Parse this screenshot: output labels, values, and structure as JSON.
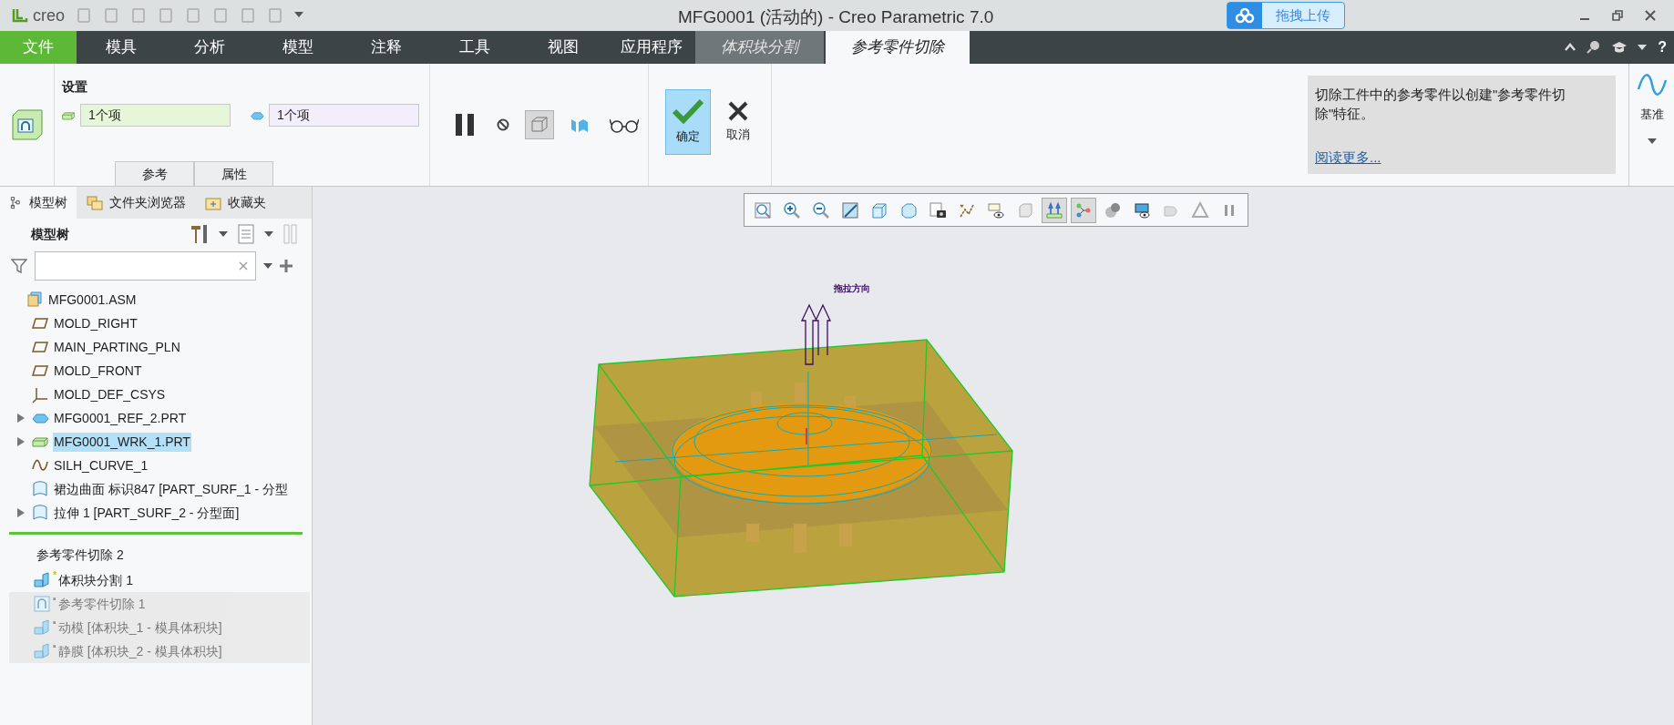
{
  "window": {
    "logo": "creo",
    "title": "MFG0001 (活动的) - Creo Parametric 7.0",
    "upload_button": "拖拽上传"
  },
  "menu_tabs": [
    {
      "label": "文件",
      "kind": "file",
      "selected": false
    },
    {
      "label": "模具",
      "kind": "normal",
      "selected": false
    },
    {
      "label": "分析",
      "kind": "normal",
      "selected": false
    },
    {
      "label": "模型",
      "kind": "normal",
      "selected": false
    },
    {
      "label": "注释",
      "kind": "normal",
      "selected": false
    },
    {
      "label": "工具",
      "kind": "normal",
      "selected": false
    },
    {
      "label": "视图",
      "kind": "normal",
      "selected": false
    },
    {
      "label": "应用程序",
      "kind": "normal",
      "selected": false
    },
    {
      "label": "体积块分割",
      "kind": "context",
      "selected": false
    },
    {
      "label": "参考零件切除",
      "kind": "context",
      "selected": true
    }
  ],
  "ribbon": {
    "settings_label": "设置",
    "collectors": [
      {
        "value": "1个项",
        "color": "#e6f7d9"
      },
      {
        "value": "1个项",
        "color": "#f3eefb"
      }
    ],
    "panel_tabs": [
      {
        "label": "参考",
        "selected": false
      },
      {
        "label": "属性",
        "selected": false
      }
    ],
    "tools": [
      {
        "pressed": false
      },
      {
        "pressed": false
      },
      {
        "pressed": true
      },
      {
        "pressed": false
      },
      {
        "pressed": false
      }
    ],
    "ok_button": {
      "label": "确定",
      "pressed": true
    },
    "cancel_button": {
      "label": "取消"
    },
    "info": {
      "text": "切除工件中的参考零件以创建\"参考零件切除\"特征。",
      "link": "阅读更多..."
    },
    "datum_label": "基准"
  },
  "sidebar": {
    "tabs": [
      {
        "label": "模型树",
        "selected": true
      },
      {
        "label": "文件夹浏览器",
        "selected": false
      },
      {
        "label": "收藏夹",
        "selected": false
      }
    ],
    "title": "模型树",
    "tree": [
      {
        "label": "MFG0001.ASM",
        "kind": "assembly",
        "expandable": false,
        "selected": false,
        "children": [
          {
            "label": "MOLD_RIGHT",
            "kind": "plane",
            "expandable": false,
            "selected": false
          },
          {
            "label": "MAIN_PARTING_PLN",
            "kind": "plane",
            "expandable": false,
            "selected": false
          },
          {
            "label": "MOLD_FRONT",
            "kind": "plane",
            "expandable": false,
            "selected": false
          },
          {
            "label": "MOLD_DEF_CSYS",
            "kind": "csys",
            "expandable": false,
            "selected": false
          },
          {
            "label": "MFG0001_REF_2.PRT",
            "kind": "refpart",
            "expandable": true,
            "selected": false
          },
          {
            "label": "MFG0001_WRK_1.PRT",
            "kind": "workpiece",
            "expandable": true,
            "selected": true
          },
          {
            "label": "SILH_CURVE_1",
            "kind": "curve",
            "expandable": false,
            "selected": false
          },
          {
            "label": "裙边曲面 标识847 [PART_SURF_1 - 分型",
            "kind": "surface",
            "expandable": false,
            "selected": false
          },
          {
            "label": "拉伸 1 [PART_SURF_2 - 分型面]",
            "kind": "surface",
            "expandable": true,
            "selected": false
          }
        ]
      }
    ],
    "insert_section": "参考零件切除 2",
    "features": [
      {
        "label": "体积块分割 1",
        "kind": "volume",
        "marker": "*",
        "disabled": false
      },
      {
        "label": "参考零件切除 1",
        "kind": "cut",
        "marker": "▪",
        "disabled": true
      },
      {
        "label": "动模 [体积块_1 - 模具体积块]",
        "kind": "volume",
        "marker": "▪",
        "disabled": true
      },
      {
        "label": "静膜 [体积块_2 - 模具体积块]",
        "kind": "volume",
        "marker": "▪",
        "disabled": true
      }
    ]
  },
  "help": "?",
  "view_toolbar": [
    {
      "pressed": false
    },
    {
      "pressed": false
    },
    {
      "pressed": false
    },
    {
      "pressed": false
    },
    {
      "pressed": false
    },
    {
      "pressed": false
    },
    {
      "pressed": false
    },
    {
      "pressed": false
    },
    {
      "pressed": false
    },
    {
      "pressed": false
    },
    {
      "pressed": true
    },
    {
      "pressed": true
    },
    {
      "pressed": false
    },
    {
      "pressed": false
    },
    {
      "pressed": false
    },
    {
      "pressed": false
    },
    {
      "pressed": false
    }
  ],
  "canvas": {
    "direction_label": "拖拉方向"
  }
}
